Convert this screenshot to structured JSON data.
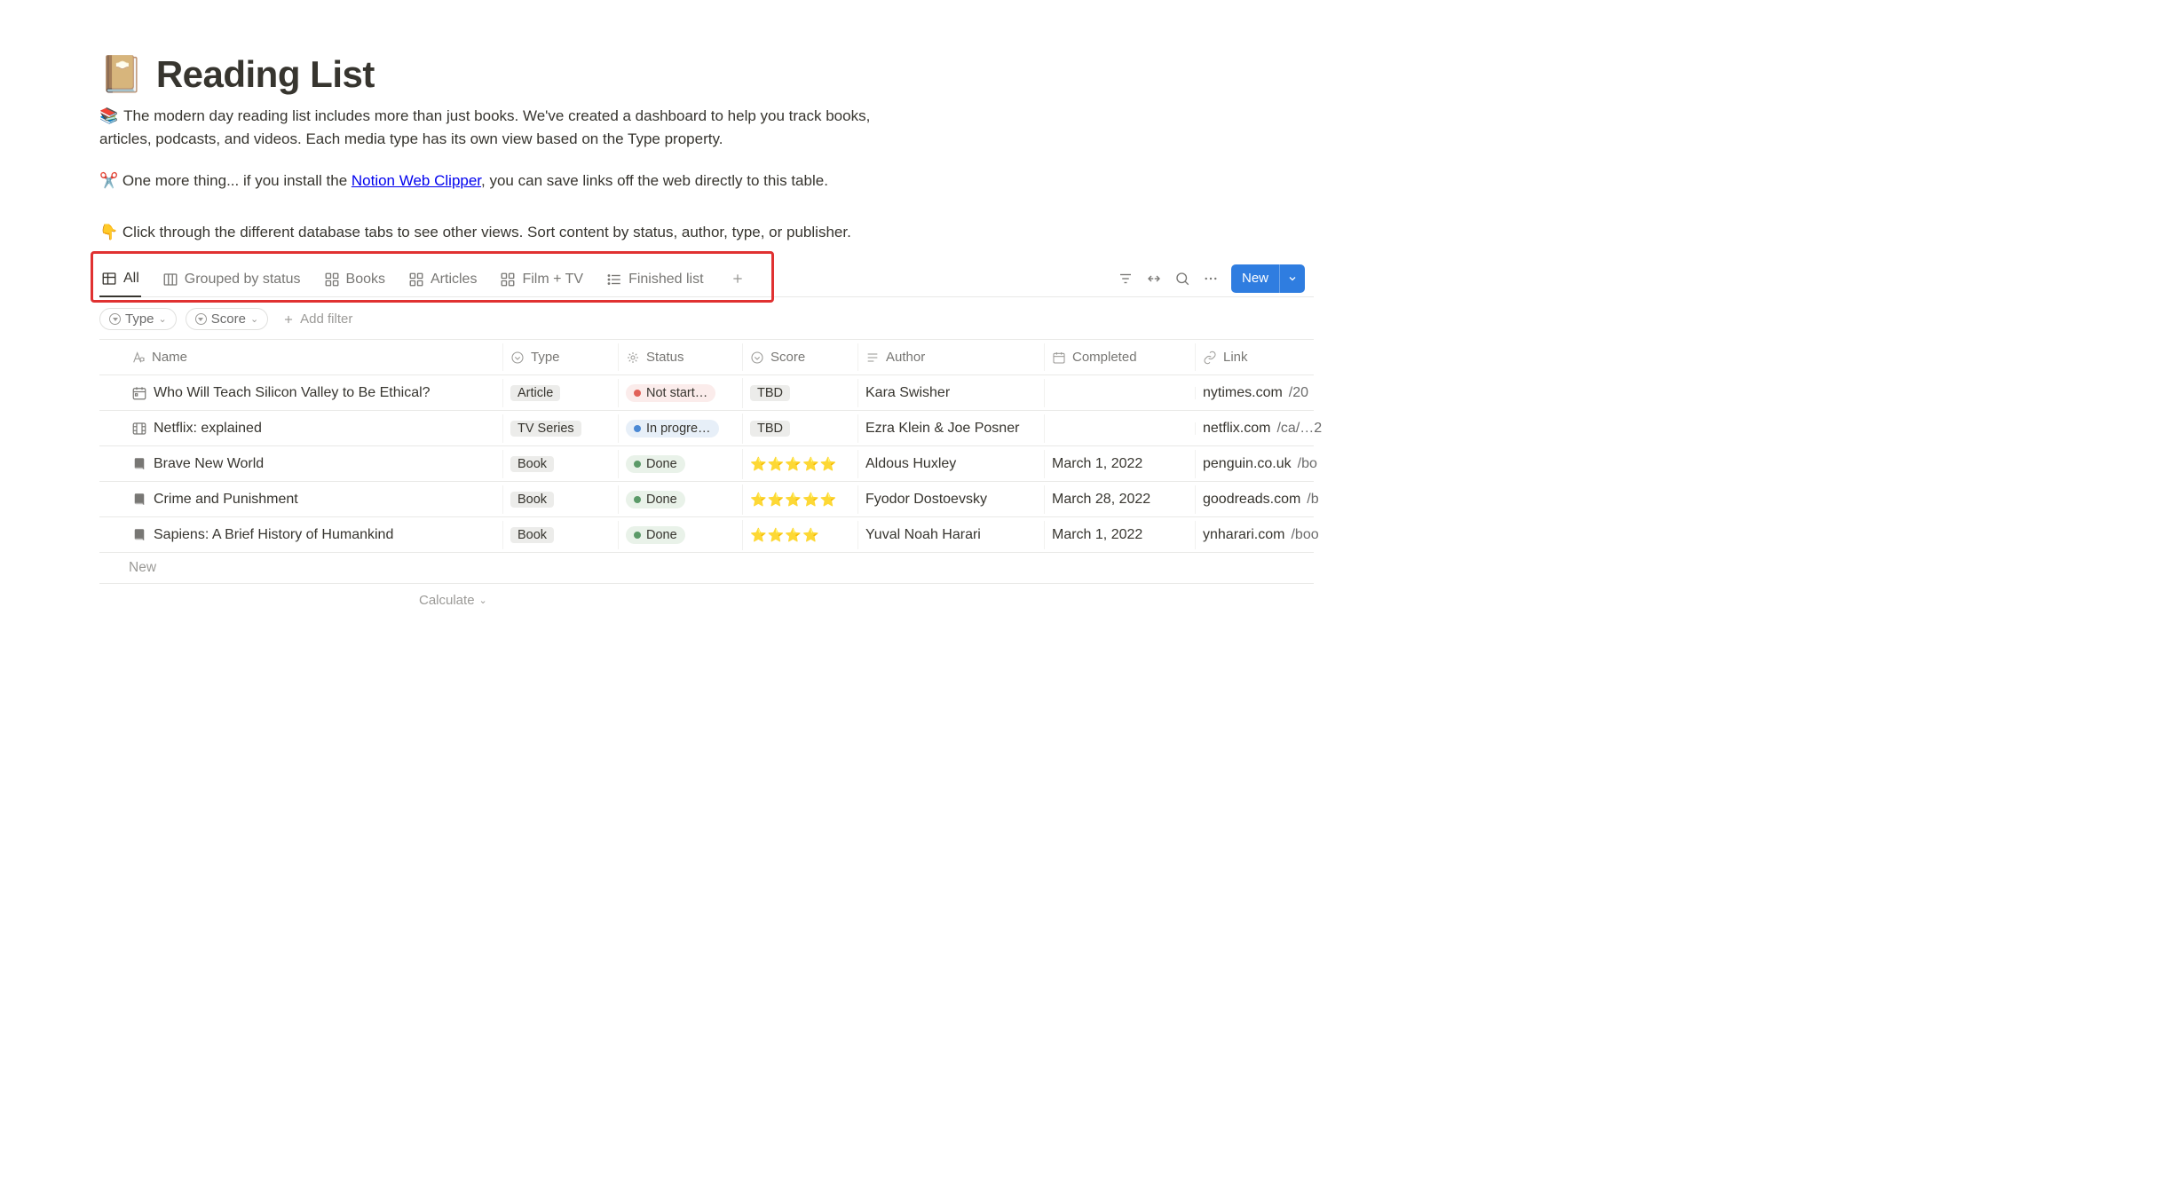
{
  "header": {
    "icon": "📔",
    "title": "Reading List",
    "desc_emoji": "📚",
    "desc_text_1": "The modern day reading list includes more than just books. We've created a dashboard to help you track books, articles, podcasts, and videos. Each media type has its own view based on the Type property.",
    "tip_emoji": "✂️",
    "tip_prefix": "One more thing... if you install the ",
    "tip_link": "Notion Web Clipper",
    "tip_suffix": ", you can save links off the web directly to this table.",
    "tip2_emoji": "👇",
    "tip2_text": "Click through the different database tabs to see other views. Sort content by status, author, type, or publisher."
  },
  "tabs": {
    "all": "All",
    "grouped": "Grouped by status",
    "books": "Books",
    "articles": "Articles",
    "filmtv": "Film + TV",
    "finished": "Finished list"
  },
  "controls": {
    "new_label": "New"
  },
  "filters": {
    "type": "Type",
    "score": "Score",
    "add": "Add filter"
  },
  "columns": {
    "name": "Name",
    "type": "Type",
    "status": "Status",
    "score": "Score",
    "author": "Author",
    "completed": "Completed",
    "link": "Link"
  },
  "rows": [
    {
      "icon": "calendar",
      "name": "Who Will Teach Silicon Valley to Be Ethical?",
      "type": "Article",
      "status_kind": "notstarted",
      "status_label": "Not start…",
      "score_tag": "TBD",
      "stars": 0,
      "author": "Kara Swisher",
      "completed": "",
      "link_domain": "nytimes.com",
      "link_rest": "/20"
    },
    {
      "icon": "film",
      "name": "Netflix: explained",
      "type": "TV Series",
      "status_kind": "inprogress",
      "status_label": "In progre…",
      "score_tag": "TBD",
      "stars": 0,
      "author": "Ezra Klein & Joe Posner",
      "completed": "",
      "link_domain": "netflix.com",
      "link_rest": "/ca/…2"
    },
    {
      "icon": "book",
      "name": "Brave New World",
      "type": "Book",
      "status_kind": "done",
      "status_label": "Done",
      "score_tag": "",
      "stars": 5,
      "author": "Aldous Huxley",
      "completed": "March 1, 2022",
      "link_domain": "penguin.co.uk",
      "link_rest": "/bo"
    },
    {
      "icon": "book",
      "name": "Crime and Punishment",
      "type": "Book",
      "status_kind": "done",
      "status_label": "Done",
      "score_tag": "",
      "stars": 5,
      "author": "Fyodor Dostoevsky",
      "completed": "March 28, 2022",
      "link_domain": "goodreads.com",
      "link_rest": "/b"
    },
    {
      "icon": "book",
      "name": "Sapiens: A Brief History of Humankind",
      "type": "Book",
      "status_kind": "done",
      "status_label": "Done",
      "score_tag": "",
      "stars": 4,
      "author": "Yuval Noah Harari",
      "completed": "March 1, 2022",
      "link_domain": "ynharari.com",
      "link_rest": "/boo"
    }
  ],
  "footer": {
    "new_row": "New",
    "calculate": "Calculate"
  }
}
